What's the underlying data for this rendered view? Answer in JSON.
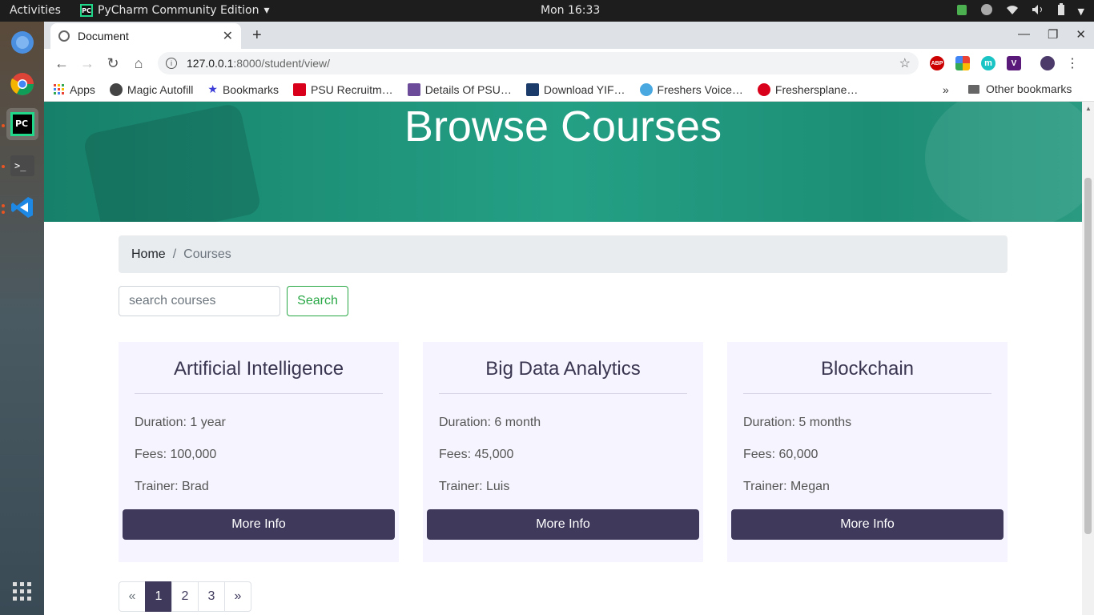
{
  "system": {
    "activities_label": "Activities",
    "app_name": "PyCharm Community Edition",
    "app_menu_arrow": "▾",
    "clock": "Mon 16:33"
  },
  "browser": {
    "tab_title": "Document",
    "url_host": "127.0.0.1",
    "url_path": ":8000/student/view/",
    "bookmarks": [
      {
        "label": "Apps",
        "color": "#ea4335"
      },
      {
        "label": "Magic Autofill",
        "color": "#444444"
      },
      {
        "label": "Bookmarks",
        "color": "#3b3bd8"
      },
      {
        "label": "PSU Recruitm…",
        "color": "#d9001b"
      },
      {
        "label": "Details Of PSU…",
        "color": "#6b4b9a"
      },
      {
        "label": "Download YIF…",
        "color": "#1b3c6b"
      },
      {
        "label": "Freshers Voice…",
        "color": "#4aa8e0"
      },
      {
        "label": "Freshersplane…",
        "color": "#d9001b"
      }
    ],
    "bookmarks_overflow": "»",
    "other_bookmarks": "Other bookmarks",
    "extensions": [
      {
        "name": "abp",
        "label": "ABP",
        "color": "#c00"
      },
      {
        "name": "colorful",
        "label": "",
        "color": "#34a853"
      },
      {
        "name": "m",
        "label": "m",
        "color": "#1bc4c4"
      },
      {
        "name": "v",
        "label": "V",
        "color": "#5a1a7a"
      }
    ]
  },
  "page": {
    "hero_title": "Browse Courses",
    "breadcrumb": {
      "home": "Home",
      "separator": "/",
      "current": "Courses"
    },
    "search": {
      "placeholder": "search courses",
      "button": "Search"
    },
    "courses": [
      {
        "title": "Artificial Intelligence",
        "duration": "Duration: 1 year",
        "fees": "Fees: 100,000",
        "trainer": "Trainer: Brad",
        "button": "More Info"
      },
      {
        "title": "Big Data Analytics",
        "duration": "Duration: 6 month",
        "fees": "Fees: 45,000",
        "trainer": "Trainer: Luis",
        "button": "More Info"
      },
      {
        "title": "Blockchain",
        "duration": "Duration: 5 months",
        "fees": "Fees: 60,000",
        "trainer": "Trainer: Megan",
        "button": "More Info"
      }
    ],
    "pagination": {
      "prev": "«",
      "pages": [
        "1",
        "2",
        "3"
      ],
      "active": "1",
      "next": "»"
    }
  },
  "colors": {
    "accent": "#3f3a5c",
    "hero_green": "#24a085",
    "search_green": "#28a745",
    "card_bg": "#f6f4fe"
  }
}
